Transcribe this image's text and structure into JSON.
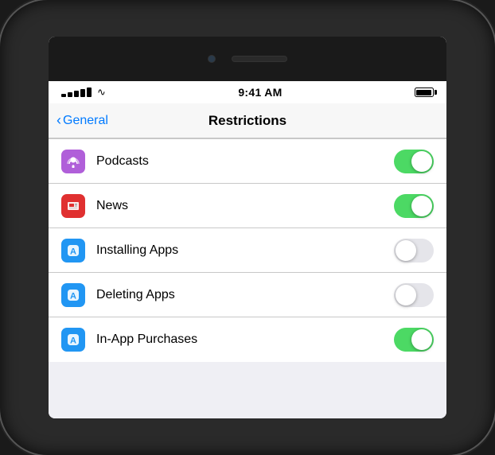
{
  "phone": {
    "status_bar": {
      "time": "9:41 AM",
      "signal_bars": 5
    },
    "nav": {
      "back_label": "General",
      "title": "Restrictions"
    },
    "items": [
      {
        "id": "podcasts",
        "label": "Podcasts",
        "icon_type": "podcasts",
        "toggle": true
      },
      {
        "id": "news",
        "label": "News",
        "icon_type": "news",
        "toggle": true
      },
      {
        "id": "installing-apps",
        "label": "Installing Apps",
        "icon_type": "apps",
        "toggle": false
      },
      {
        "id": "deleting-apps",
        "label": "Deleting Apps",
        "icon_type": "apps",
        "toggle": false
      },
      {
        "id": "in-app-purchases",
        "label": "In-App Purchases",
        "icon_type": "apps",
        "toggle": true
      }
    ]
  }
}
